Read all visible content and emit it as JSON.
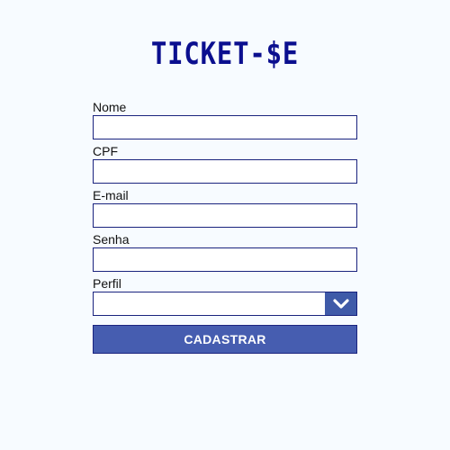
{
  "app": {
    "logo": "TICKET-$E"
  },
  "form": {
    "fields": [
      {
        "label": "Nome",
        "value": "",
        "placeholder": ""
      },
      {
        "label": "CPF",
        "value": "",
        "placeholder": ""
      },
      {
        "label": "E-mail",
        "value": "",
        "placeholder": ""
      },
      {
        "label": "Senha",
        "value": "",
        "placeholder": ""
      }
    ],
    "profile": {
      "label": "Perfil",
      "selected": "",
      "icon": "chevron-down-icon"
    },
    "submit_label": "CADASTRAR"
  },
  "colors": {
    "background": "#f7fbff",
    "brand": "#0b0f8f",
    "border": "#1a237e",
    "button": "#465db0",
    "dropdown_arrow_bg": "#3f5aa8"
  }
}
